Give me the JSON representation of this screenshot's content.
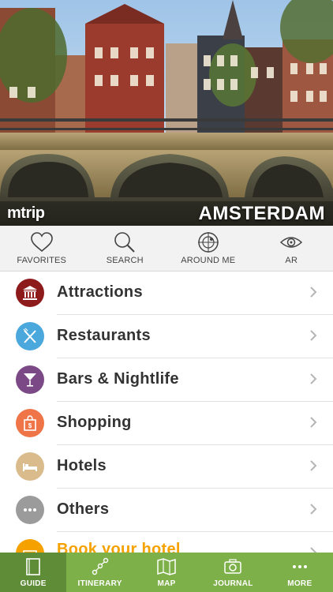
{
  "hero": {
    "brand": "mtrip",
    "city": "AMSTERDAM"
  },
  "quickbar": [
    {
      "label": "FAVORITES",
      "icon": "heart-icon"
    },
    {
      "label": "SEARCH",
      "icon": "search-icon"
    },
    {
      "label": "AROUND ME",
      "icon": "radar-icon"
    },
    {
      "label": "AR",
      "icon": "eye-icon"
    }
  ],
  "categories": [
    {
      "label": "Attractions",
      "icon": "museum-icon",
      "color": "#8e1b1b"
    },
    {
      "label": "Restaurants",
      "icon": "fork-knife-icon",
      "color": "#4aa8dc"
    },
    {
      "label": "Bars & Nightlife",
      "icon": "cocktail-icon",
      "color": "#7b4a86"
    },
    {
      "label": "Shopping",
      "icon": "shopping-bag-icon",
      "color": "#ef7548"
    },
    {
      "label": "Hotels",
      "icon": "bed-icon",
      "color": "#d9bb8c"
    },
    {
      "label": "Others",
      "icon": "dots-icon",
      "color": "#9b9b9b"
    },
    {
      "label": "Book your hotel",
      "icon": "booking-icon",
      "color": "#f5a100"
    }
  ],
  "tabs": [
    {
      "label": "GUIDE",
      "icon": "book-icon",
      "active": true
    },
    {
      "label": "ITINERARY",
      "icon": "route-icon",
      "active": false
    },
    {
      "label": "MAP",
      "icon": "map-icon",
      "active": false
    },
    {
      "label": "JOURNAL",
      "icon": "camera-icon",
      "active": false
    },
    {
      "label": "MORE",
      "icon": "more-dots-icon",
      "active": false
    }
  ],
  "colors": {
    "tabbar": "#7eb04a",
    "tab_active": "#5f8c36",
    "accent_orange": "#f5a100"
  }
}
